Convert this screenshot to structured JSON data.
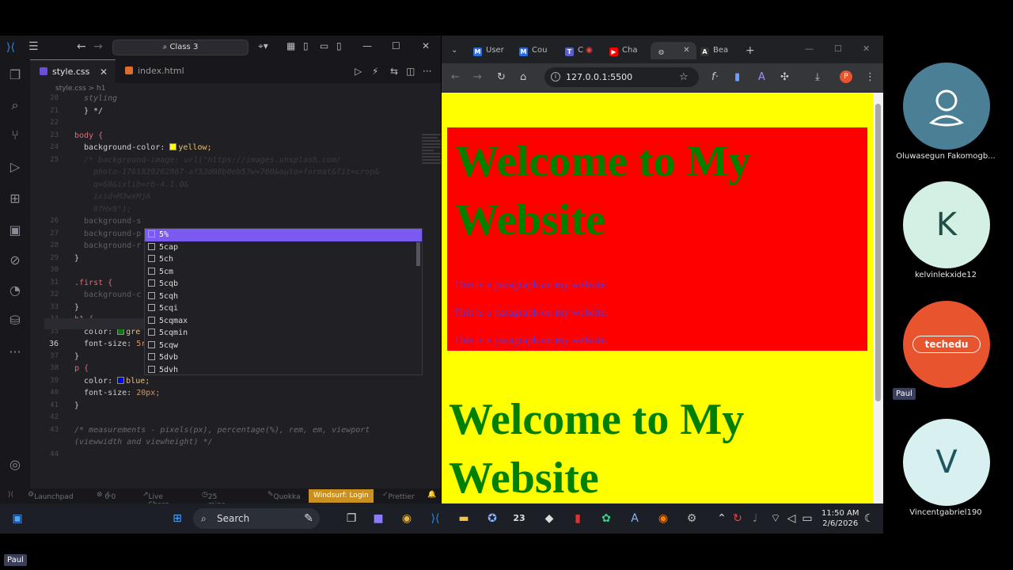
{
  "vscode": {
    "search": "Class 3",
    "tabs": [
      {
        "label": "style.css",
        "active": true
      },
      {
        "label": "index.html",
        "active": false
      }
    ],
    "breadcrumb": "style.css > h1",
    "lines": [
      {
        "n": "20",
        "text": "styling"
      },
      {
        "n": "21",
        "text": "} */"
      },
      {
        "n": "22",
        "text": ""
      },
      {
        "n": "23",
        "text": "body {"
      },
      {
        "n": "24",
        "text": "background-color: "
      },
      {
        "n": "25",
        "text": "/* background-image: url(\"https://images.unsplash.com/"
      },
      {
        "n": "",
        "text": "photo-1761839262867-af53d08b0eb5?w=700&auto=format&fit=crop&"
      },
      {
        "n": "",
        "text": "q=60&ixlib=rb-4.1.0&"
      },
      {
        "n": "",
        "text": "ixid=M3wxMjA"
      },
      {
        "n": "",
        "text": "8fHx8\");"
      },
      {
        "n": "26",
        "text": "background-s"
      },
      {
        "n": "27",
        "text": "background-p"
      },
      {
        "n": "28",
        "text": "background-r"
      },
      {
        "n": "29",
        "text": "}"
      },
      {
        "n": "30",
        "text": ""
      },
      {
        "n": "31",
        "text": ".first {"
      },
      {
        "n": "32",
        "text": "background-c"
      },
      {
        "n": "33",
        "text": "}"
      },
      {
        "n": "34",
        "text": "h1 {"
      },
      {
        "n": "35",
        "text": "color: "
      },
      {
        "n": "36",
        "text": "font-size: "
      },
      {
        "n": "37",
        "text": "}"
      },
      {
        "n": "38",
        "text": "p {"
      },
      {
        "n": "39",
        "text": "color: "
      },
      {
        "n": "40",
        "text": "font-size: "
      },
      {
        "n": "41",
        "text": "}"
      },
      {
        "n": "42",
        "text": ""
      },
      {
        "n": "43",
        "text": "/* measurements - pixels(px), percentage(%), rem, em, viewport"
      },
      {
        "n": "",
        "text": "(viewwidth and viewheight) */"
      },
      {
        "n": "44",
        "text": ""
      }
    ],
    "values": {
      "body_bg": "yellow;",
      "h1_color": "gre",
      "h1_size": "5rem;",
      "p_color": "blue;",
      "p_size": "20px;"
    },
    "suggestions": [
      "5%",
      "5cap",
      "5ch",
      "5cm",
      "5cqb",
      "5cqh",
      "5cqi",
      "5cqmax",
      "5cqmin",
      "5cqw",
      "5dvb",
      "5dvh"
    ],
    "status": {
      "launchpad": "Launchpad",
      "errors": "0",
      "warnings": "0",
      "liveshare": "Live Share",
      "time": "25 mins",
      "quokka": "Quokka",
      "windsurf": "Windsurf: Login",
      "prettier": "Prettier"
    },
    "colors": {
      "yellow": "#ffff00",
      "green": "#008000",
      "blue": "#0000ff",
      "accent": "#7a5af0"
    }
  },
  "browser": {
    "tabs": [
      {
        "label": "User",
        "icon": "M"
      },
      {
        "label": "Cou",
        "icon": "M"
      },
      {
        "label": "C",
        "icon": "T"
      },
      {
        "label": "Cha",
        "icon": "▶"
      },
      {
        "label": "",
        "icon": "globe",
        "active": true
      },
      {
        "label": "Bea",
        "icon": "A"
      }
    ],
    "url": "127.0.0.1:5500",
    "profile_initial": "P",
    "page": {
      "h1_first": "Welcome to My Website",
      "paragraphs": [
        "This is a paragraph on my website.",
        "This is a paragraph on my website.",
        "This is a paragraph on my website."
      ],
      "h1_second": "Welcome to My Website"
    }
  },
  "taskbar": {
    "search": "Search",
    "badge": "23",
    "time": "11:50 AM",
    "date": "2/6/2026"
  },
  "participants": [
    {
      "name": "Oluwasegun Fakomogb...",
      "initial": "",
      "bg": "#4a7f96"
    },
    {
      "name": "kelvinlekxide12",
      "initial": "K",
      "bg": "#d4efe3"
    },
    {
      "name": "Paul",
      "initial": "techedu",
      "bg": "#e8542e"
    },
    {
      "name": "Vincentgabriel190",
      "initial": "V",
      "bg": "#d8f0f0"
    }
  ],
  "self_label": "Paul"
}
